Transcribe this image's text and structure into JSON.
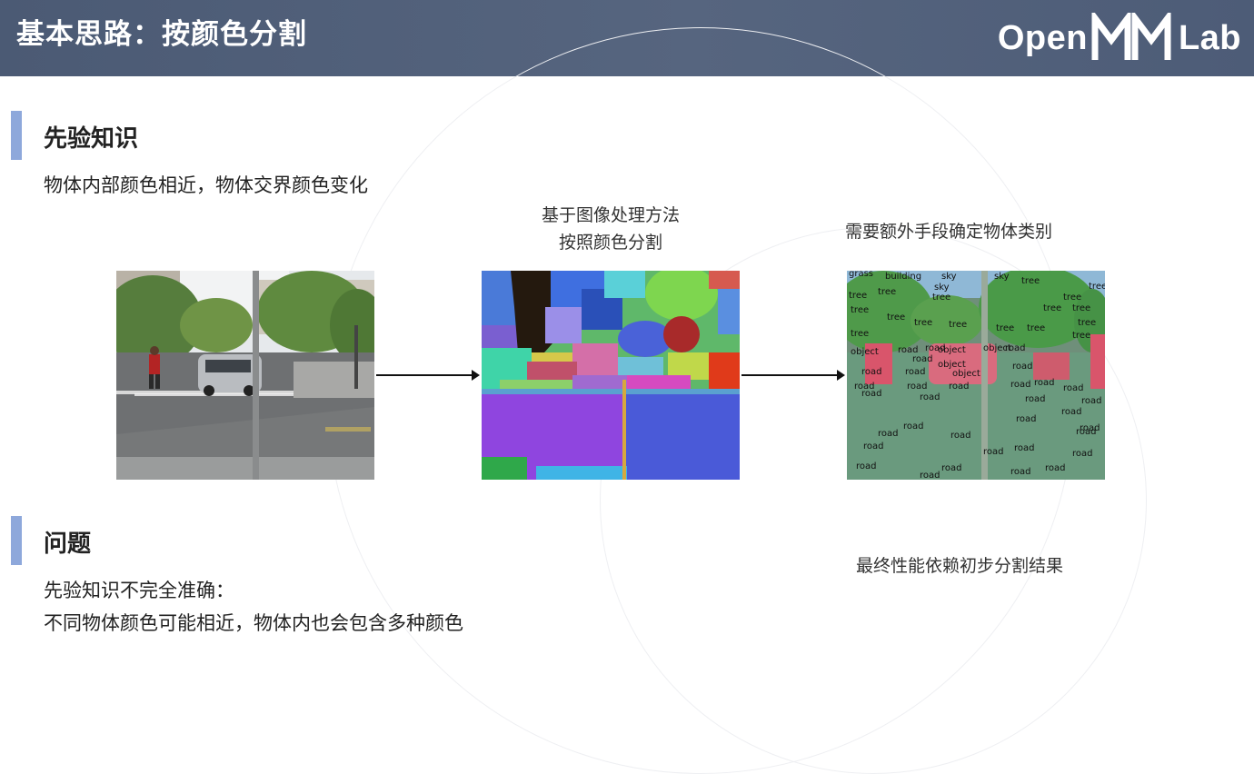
{
  "slide_title": "基本思路：按颜色分割",
  "logo": {
    "left": "Open",
    "right": "Lab",
    "mark_icon": "mm-logo-icon"
  },
  "section1": {
    "heading": "先验知识",
    "text": "物体内部颜色相近，物体交界颜色变化"
  },
  "middle_caption": {
    "line1": "基于图像处理方法",
    "line2": "按照颜色分割"
  },
  "right_caption": "需要额外手段确定物体类别",
  "bottom_right_caption": "最终性能依赖初步分割结果",
  "section2": {
    "heading": "问题",
    "line1": "先验知识不完全准确：",
    "line2": "不同物体颜色可能相近，物体内也会包含多种颜色"
  },
  "labels": {
    "grass": "grass",
    "building": "building",
    "sky": "sky",
    "tree": "tree",
    "object": "object",
    "road": "road"
  },
  "colors": {
    "header": "#4f5e79",
    "accent": "#8ea8db",
    "label_overlay_green": "#5a9b6a",
    "label_overlay_red": "#d9556b"
  }
}
